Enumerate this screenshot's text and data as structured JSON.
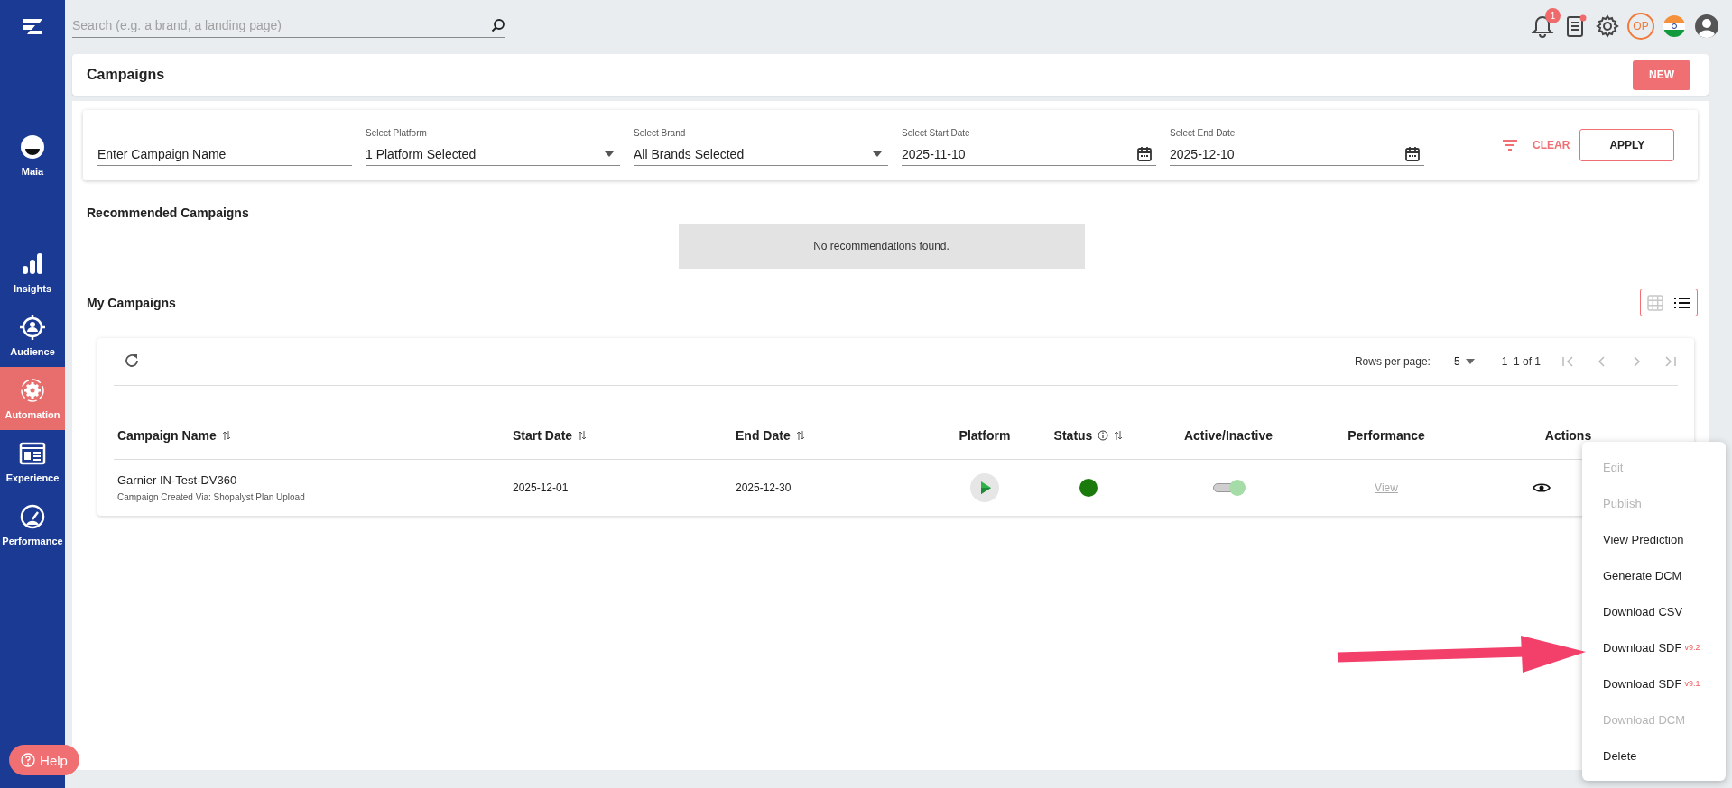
{
  "sidebar": {
    "items": [
      {
        "label": "Maia",
        "selected": false
      },
      {
        "label": "Insights",
        "selected": false
      },
      {
        "label": "Audience",
        "selected": false
      },
      {
        "label": "Automation",
        "selected": true
      },
      {
        "label": "Experience",
        "selected": false
      },
      {
        "label": "Performance",
        "selected": false
      }
    ],
    "help": "Help"
  },
  "top_bar": {
    "search": {
      "placeholder": "Search (e.g. a brand, a landing page)"
    },
    "notification_count": "1",
    "user_initials": "OP"
  },
  "header": {
    "title": "Campaigns",
    "new_button": "NEW"
  },
  "filters": {
    "fields": [
      {
        "kind": "text",
        "placeholder": "Enter Campaign Name"
      },
      {
        "kind": "select",
        "label": "Select Platform",
        "value": "1 Platform Selected"
      },
      {
        "kind": "select",
        "label": "Select Brand",
        "value": "All Brands Selected"
      },
      {
        "kind": "date",
        "label": "Select Start Date",
        "value": "2025-11-10"
      },
      {
        "kind": "date",
        "label": "Select End Date",
        "value": "2025-12-10"
      }
    ],
    "clear": "CLEAR",
    "apply": "APPLY"
  },
  "recommended": {
    "title": "Recommended Campaigns",
    "empty_message": "No recommendations found."
  },
  "my_campaigns": {
    "title": "My Campaigns",
    "views": [
      {
        "kind": "grid",
        "selected": false
      },
      {
        "kind": "list",
        "selected": true
      }
    ],
    "table": {
      "rows_per_page_label": "Rows per page:",
      "rows_per_page": "5",
      "range": "1–1 of 1",
      "columns": [
        {
          "label": "Campaign Name",
          "sortable": true,
          "info": false
        },
        {
          "label": "Start Date",
          "sortable": true,
          "info": false
        },
        {
          "label": "End Date",
          "sortable": true,
          "info": false
        },
        {
          "label": "Platform",
          "sortable": false,
          "info": false
        },
        {
          "label": "Status",
          "sortable": true,
          "info": true
        },
        {
          "label": "Active/Inactive",
          "sortable": false,
          "info": false
        },
        {
          "label": "Performance",
          "sortable": false,
          "info": false
        },
        {
          "label": "Actions",
          "sortable": false,
          "info": false
        }
      ],
      "rows": [
        {
          "name": "Garnier IN-Test-DV360",
          "subtitle": "Campaign Created Via: Shopalyst Plan Upload",
          "start_date": "2025-12-01",
          "end_date": "2025-12-30",
          "status": {
            "color": "#1a7a0c"
          },
          "active": true,
          "performance": "View"
        }
      ]
    }
  },
  "actions_menu": {
    "items": [
      {
        "label": "Edit",
        "disabled": true
      },
      {
        "label": "Publish",
        "disabled": true
      },
      {
        "label": "View Prediction",
        "disabled": false
      },
      {
        "label": "Generate DCM",
        "disabled": false
      },
      {
        "label": "Download CSV",
        "disabled": false
      },
      {
        "label": "Download SDF",
        "version": "v9.2",
        "disabled": false
      },
      {
        "label": "Download SDF",
        "version": "v9.1",
        "disabled": false
      },
      {
        "label": "Download DCM",
        "disabled": true
      },
      {
        "label": "Delete",
        "disabled": false
      }
    ]
  }
}
